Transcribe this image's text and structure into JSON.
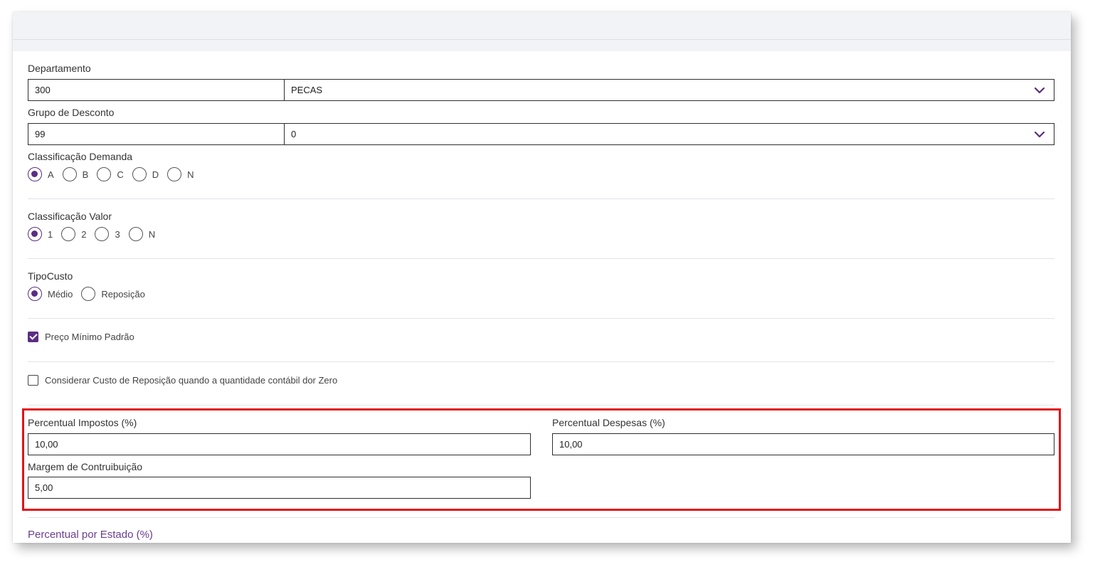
{
  "departamento": {
    "label": "Departamento",
    "code": "300",
    "selected": "PECAS"
  },
  "grupo_desconto": {
    "label": "Grupo de Desconto",
    "code": "99",
    "selected": "0"
  },
  "classificacao_demanda": {
    "label": "Classificação Demanda",
    "options": [
      "A",
      "B",
      "C",
      "D",
      "N"
    ],
    "selected": "A"
  },
  "classificacao_valor": {
    "label": "Classificação Valor",
    "options": [
      "1",
      "2",
      "3",
      "N"
    ],
    "selected": "1"
  },
  "tipo_custo": {
    "label": "TipoCusto",
    "options": [
      "Médio",
      "Reposição"
    ],
    "selected": "Médio"
  },
  "preco_minimo": {
    "label": "Preço Mínimo Padrão",
    "checked": true
  },
  "considerar_custo": {
    "label": "Considerar Custo de Reposição quando a quantidade contábil dor Zero",
    "checked": false
  },
  "percentuais": {
    "impostos_label": "Percentual Impostos (%)",
    "impostos_value": "10,00",
    "despesas_label": "Percentual Despesas (%)",
    "despesas_value": "10,00",
    "margem_label": "Margem de Contruibuição",
    "margem_value": "5,00"
  },
  "percentual_estado": {
    "title": "Percentual por Estado (%)"
  },
  "colors": {
    "accent": "#5a2d82",
    "highlight": "#e3121a",
    "topbar": "#f2f3f6"
  },
  "icons": {
    "dropdown": "chevron-down-icon",
    "check": "check-icon"
  }
}
